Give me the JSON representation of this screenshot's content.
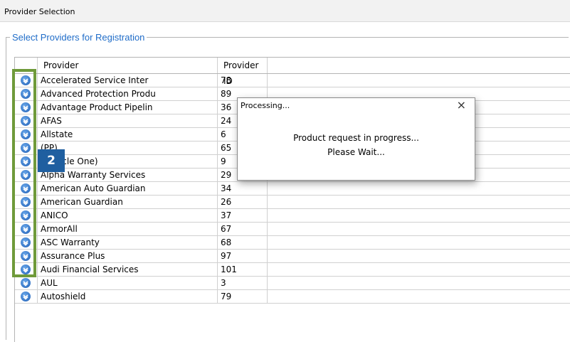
{
  "window": {
    "title": "Provider Selection"
  },
  "group": {
    "legend": "Select Providers for Registration"
  },
  "table": {
    "columns": [
      "Provider",
      "Provider ID"
    ],
    "rows": [
      {
        "provider": "Accelerated Service Inter",
        "id": "78"
      },
      {
        "provider": "Advanced Protection Produ",
        "id": "89"
      },
      {
        "provider": "Advantage Product Pipelin",
        "id": "36"
      },
      {
        "provider": "AFAS",
        "id": "24"
      },
      {
        "provider": "Allstate",
        "id": "6"
      },
      {
        "provider": "(PP)",
        "id": "65"
      },
      {
        "provider": "(Vehicle One)",
        "id": "9"
      },
      {
        "provider": "Alpha Warranty Services",
        "id": "29"
      },
      {
        "provider": "American Auto Guardian",
        "id": "34"
      },
      {
        "provider": "American Guardian",
        "id": "26"
      },
      {
        "provider": "ANICO",
        "id": "37"
      },
      {
        "provider": "ArmorAll",
        "id": "67"
      },
      {
        "provider": "ASC Warranty",
        "id": "68"
      },
      {
        "provider": "Assurance Plus",
        "id": "97"
      },
      {
        "provider": "Audi Financial Services",
        "id": "101"
      },
      {
        "provider": "AUL",
        "id": "3"
      },
      {
        "provider": "Autoshield",
        "id": "79"
      }
    ]
  },
  "callout": {
    "number": "2",
    "color": "#6f9a3a",
    "badge_color": "#1f5fa0"
  },
  "dialog": {
    "title": "Processing...",
    "close": "×",
    "message_line1": "Product request in progress...",
    "message_line2": "Please Wait..."
  },
  "icons": {
    "row_select": "chevron-down-circle-icon"
  }
}
